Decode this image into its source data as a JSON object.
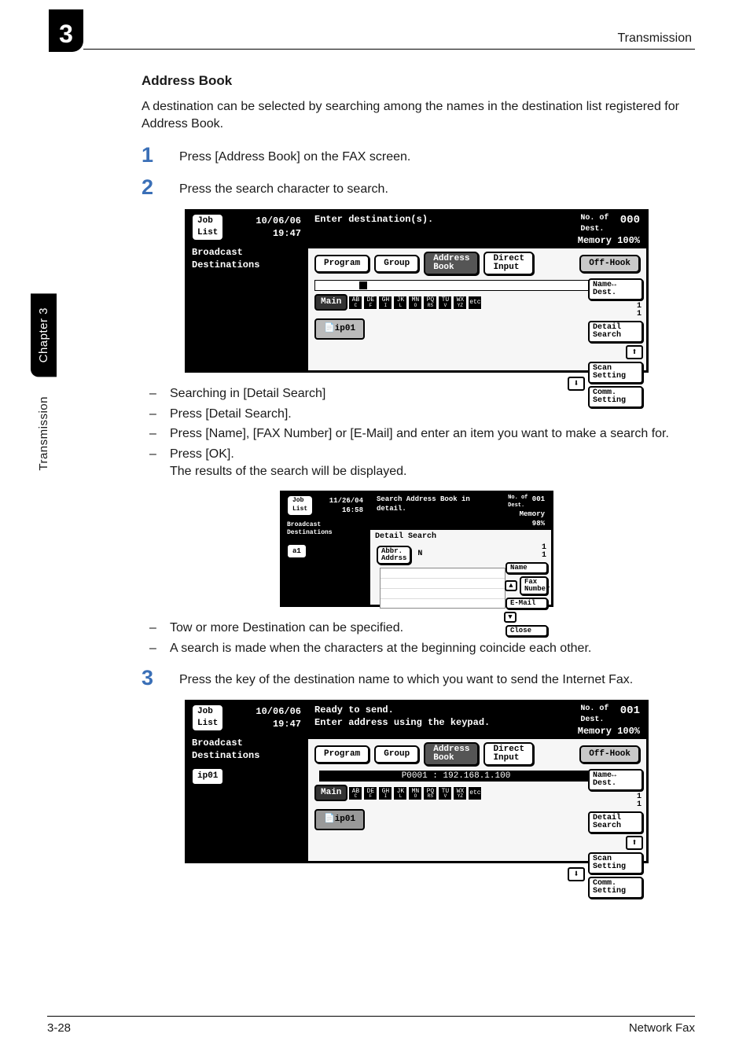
{
  "chapter_tab": "3",
  "running_head": "Transmission",
  "side_label": {
    "chapter": "Chapter 3",
    "section": "Transmission"
  },
  "heading": "Address Book",
  "intro": "A destination can be selected by searching among the names in the destination list registered for Address Book.",
  "steps": {
    "s1": {
      "n": "1",
      "t": "Press [Address Book] on the FAX screen."
    },
    "s2": {
      "n": "2",
      "t": "Press the search character to search."
    },
    "s3": {
      "n": "3",
      "t": "Press the key of the destination name to which you want to send the Internet Fax."
    }
  },
  "bullets": {
    "a": "Searching in [Detail Search]",
    "b": "Press [Detail Search].",
    "c": "Press [Name], [FAX Number] or [E-Mail] and enter an item you want to make a search for.",
    "d": "Press [OK].",
    "d_sub": "The results of the search will be displayed.",
    "e": "Tow or more Destination can be specified.",
    "f": "A search is made when the characters at the beginning coincide each other."
  },
  "lcd_common": {
    "job": "Job\nList",
    "bc": "Broadcast\nDestinations",
    "tabs": {
      "program": "Program",
      "group": "Group",
      "address": "Address\nBook",
      "direct": "Direct\nInput",
      "offhook": "Off-Hook"
    },
    "main": "Main",
    "keys": [
      [
        "AB",
        "C"
      ],
      [
        "DE",
        "F"
      ],
      [
        "GH",
        "I"
      ],
      [
        "JK",
        "L"
      ],
      [
        "MN",
        "O"
      ],
      [
        "PQ",
        "RS"
      ],
      [
        "TU",
        "V"
      ],
      [
        "WX",
        "YZ"
      ],
      [
        "etc",
        ""
      ]
    ],
    "side": {
      "name": "Name↔\nDest.",
      "detail": "Detail\nSearch",
      "scan": "Scan\nSetting",
      "comm": "Comm.\nSetting"
    },
    "count": "1\n1",
    "dest_label": "No. of\nDest."
  },
  "lcd1": {
    "date": "10/06/06\n19:47",
    "prompt": "Enter destination(s).",
    "dest": "000",
    "mem": "Memory 100%",
    "chip": "ip01"
  },
  "lcd2": {
    "date": "11/26/04\n16:58",
    "prompt": "Search Address Book in detail.",
    "dest": "001",
    "mem": "Memory  98%",
    "title": "Detail Search",
    "a1": "a1",
    "abbr": "Abbr.\nAddrss",
    "n": "N",
    "btns": {
      "name": "Name",
      "fax": "Fax\nNumber",
      "email": "E-Mail",
      "close": "Close"
    }
  },
  "lcd3": {
    "date": "10/06/06\n19:47",
    "prompt_a": "Ready to send.",
    "prompt_b": "Enter address using the keypad.",
    "dest": "001",
    "mem": "Memory 100%",
    "sel": "ip01",
    "info": "P0001 : 192.168.1.100",
    "chip": "ip01"
  },
  "footer": {
    "l": "3-28",
    "r": "Network Fax"
  }
}
